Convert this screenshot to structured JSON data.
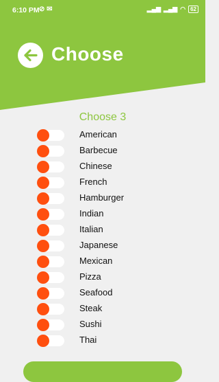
{
  "status_bar": {
    "time": "6:10 PM",
    "battery": "62"
  },
  "header": {
    "title": "Choose"
  },
  "prompt": "Choose 3",
  "cuisines": [
    {
      "label": "American",
      "selected": false
    },
    {
      "label": "Barbecue",
      "selected": false
    },
    {
      "label": "Chinese",
      "selected": false
    },
    {
      "label": "French",
      "selected": false
    },
    {
      "label": "Hamburger",
      "selected": false
    },
    {
      "label": "Indian",
      "selected": false
    },
    {
      "label": "Italian",
      "selected": false
    },
    {
      "label": "Japanese",
      "selected": false
    },
    {
      "label": "Mexican",
      "selected": false
    },
    {
      "label": "Pizza",
      "selected": false
    },
    {
      "label": "Seafood",
      "selected": false
    },
    {
      "label": "Steak",
      "selected": false
    },
    {
      "label": "Sushi",
      "selected": false
    },
    {
      "label": "Thai",
      "selected": false
    }
  ],
  "colors": {
    "brand_green": "#8dc63f",
    "toggle_knob": "#ff4f0f",
    "background": "#f0f0f0"
  }
}
